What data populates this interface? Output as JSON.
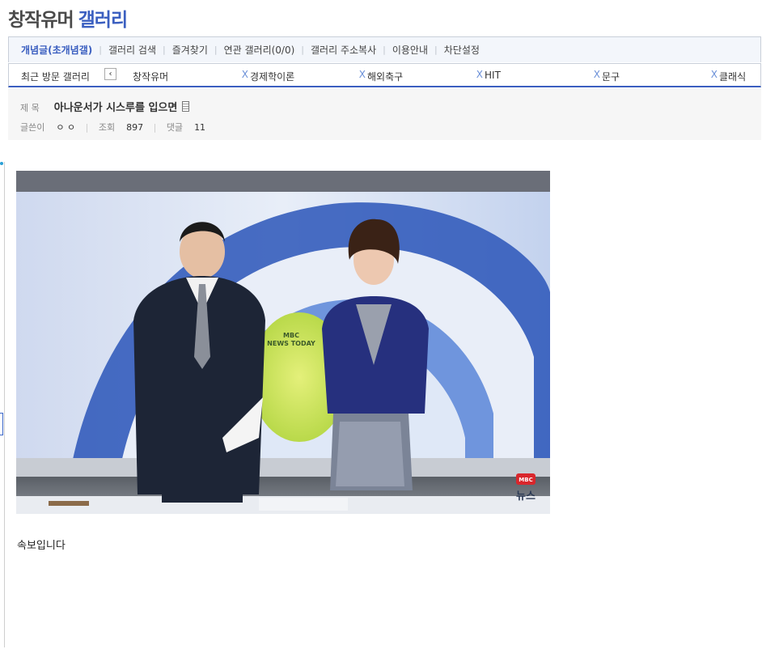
{
  "gallery": {
    "name": "창작유머",
    "suffix": "갤러리"
  },
  "menu": {
    "items": [
      "개념글(초개념갤)",
      "갤러리 검색",
      "즐겨찾기",
      "연관 갤러리(0/0)",
      "갤러리 주소복사",
      "이용안내",
      "차단설정"
    ]
  },
  "recent": {
    "label": "최근 방문 갤러리",
    "prev_icon": "‹",
    "close_icon": "X",
    "galleries": [
      "창작유머",
      "경제학이론",
      "해외축구",
      "HIT",
      "문구",
      "클래식"
    ]
  },
  "post": {
    "subject_label": "제 목",
    "subject": "아나운서가 시스루를 입으면",
    "author_label": "글쓴이",
    "author": "ㅇ ㅇ",
    "views_label": "조회",
    "views": "897",
    "comments_label": "댓글",
    "comments": "11",
    "body": "속보입니다"
  },
  "image": {
    "screen_logo_line1": "MBC",
    "screen_logo_line2": "NEWS TODAY",
    "corner_logo_line1": "MBC",
    "corner_logo_line2": "뉴스"
  }
}
